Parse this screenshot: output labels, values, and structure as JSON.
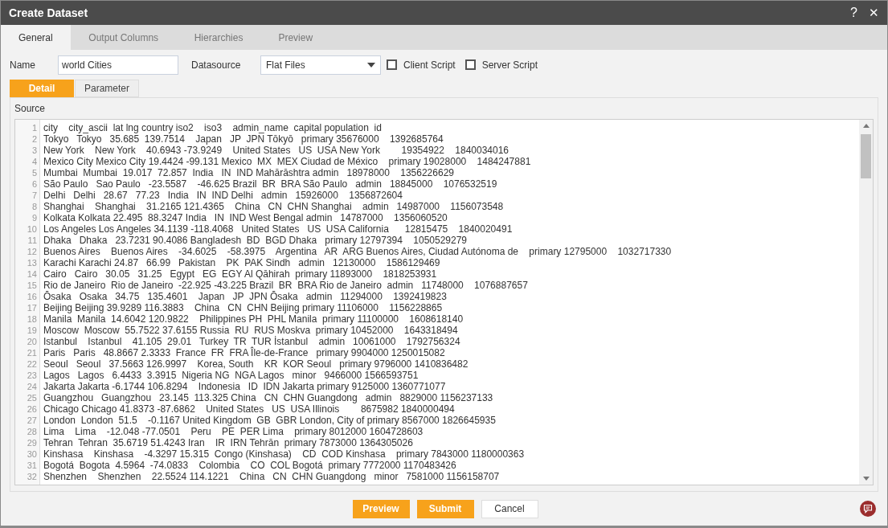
{
  "window": {
    "title": "Create Dataset",
    "help": "?",
    "close": "✕"
  },
  "tabs": [
    {
      "label": "General",
      "selected": true
    },
    {
      "label": "Output Columns",
      "selected": false
    },
    {
      "label": "Hierarchies",
      "selected": false
    },
    {
      "label": "Preview",
      "selected": false
    }
  ],
  "name_field": {
    "label": "Name",
    "value": "world Cities"
  },
  "datasource": {
    "label": "Datasource",
    "value": "Flat Files"
  },
  "checkboxes": [
    {
      "label": "Client Script",
      "checked": false
    },
    {
      "label": "Server Script",
      "checked": false
    }
  ],
  "subtabs": [
    {
      "label": "Detail",
      "selected": true
    },
    {
      "label": "Parameter",
      "selected": false
    }
  ],
  "source": {
    "label": "Source",
    "lines": [
      {
        "number": "1",
        "text": "city    city_ascii  lat lng country iso2    iso3    admin_name  capital population  id"
      },
      {
        "number": "2",
        "text": "Tokyo   Tokyo   35.685  139.7514    Japan   JP  JPN Tōkyō   primary 35676000    1392685764"
      },
      {
        "number": "3",
        "text": "New York    New York    40.6943 -73.9249    United States   US  USA New York        19354922    1840034016"
      },
      {
        "number": "4",
        "text": "Mexico City Mexico City 19.4424 -99.131 Mexico  MX  MEX Ciudad de México    primary 19028000    1484247881"
      },
      {
        "number": "5",
        "text": "Mumbai  Mumbai  19.017  72.857  India   IN  IND Mahārāshtra admin   18978000    1356226629"
      },
      {
        "number": "6",
        "text": "São Paulo   Sao Paulo   -23.5587    -46.625 Brazil  BR  BRA São Paulo   admin   18845000    1076532519"
      },
      {
        "number": "7",
        "text": "Delhi   Delhi   28.67   77.23   India   IN  IND Delhi   admin   15926000    1356872604"
      },
      {
        "number": "8",
        "text": "Shanghai    Shanghai    31.2165 121.4365    China   CN  CHN Shanghai    admin   14987000    1156073548"
      },
      {
        "number": "9",
        "text": "Kolkata Kolkata 22.495  88.3247 India   IN  IND West Bengal admin   14787000    1356060520"
      },
      {
        "number": "10",
        "text": "Los Angeles Los Angeles 34.1139 -118.4068   United States   US  USA California      12815475    1840020491"
      },
      {
        "number": "11",
        "text": "Dhaka   Dhaka   23.7231 90.4086 Bangladesh  BD  BGD Dhaka   primary 12797394    1050529279"
      },
      {
        "number": "12",
        "text": "Buenos Aires    Buenos Aires    -34.6025    -58.3975    Argentina   AR  ARG Buenos Aires, Ciudad Autónoma de    primary 12795000    1032717330"
      },
      {
        "number": "13",
        "text": "Karachi Karachi 24.87   66.99   Pakistan    PK  PAK Sindh   admin   12130000    1586129469"
      },
      {
        "number": "14",
        "text": "Cairo   Cairo   30.05   31.25   Egypt   EG  EGY Al Qāhirah  primary 11893000    1818253931"
      },
      {
        "number": "15",
        "text": "Rio de Janeiro  Rio de Janeiro  -22.925 -43.225 Brazil  BR  BRA Rio de Janeiro  admin   11748000    1076887657"
      },
      {
        "number": "16",
        "text": "Ōsaka   Osaka   34.75   135.4601    Japan   JP  JPN Ōsaka   admin   11294000    1392419823"
      },
      {
        "number": "17",
        "text": "Beijing Beijing 39.9289 116.3883    China   CN  CHN Beijing primary 11106000    1156228865"
      },
      {
        "number": "18",
        "text": "Manila  Manila  14.6042 120.9822    Philippines PH  PHL Manila  primary 11100000    1608618140"
      },
      {
        "number": "19",
        "text": "Moscow  Moscow  55.7522 37.6155 Russia  RU  RUS Moskva  primary 10452000    1643318494"
      },
      {
        "number": "20",
        "text": "Istanbul    Istanbul    41.105  29.01   Turkey  TR  TUR İstanbul    admin   10061000    1792756324"
      },
      {
        "number": "21",
        "text": "Paris   Paris   48.8667 2.3333  France  FR  FRA Île-de-France   primary 9904000 1250015082"
      },
      {
        "number": "22",
        "text": "Seoul   Seoul   37.5663 126.9997    Korea, South    KR  KOR Seoul   primary 9796000 1410836482"
      },
      {
        "number": "23",
        "text": "Lagos   Lagos   6.4433  3.3915  Nigeria NG  NGA Lagos   minor   9466000 1566593751"
      },
      {
        "number": "24",
        "text": "Jakarta Jakarta -6.1744 106.8294    Indonesia   ID  IDN Jakarta primary 9125000 1360771077"
      },
      {
        "number": "25",
        "text": "Guangzhou   Guangzhou   23.145  113.325 China   CN  CHN Guangdong   admin   8829000 1156237133"
      },
      {
        "number": "26",
        "text": "Chicago Chicago 41.8373 -87.6862    United States   US  USA Illinois        8675982 1840000494"
      },
      {
        "number": "27",
        "text": "London  London  51.5    -0.1167 United Kingdom  GB  GBR London, City of primary 8567000 1826645935"
      },
      {
        "number": "28",
        "text": "Lima    Lima    -12.048 -77.0501    Peru    PE  PER Lima    primary 8012000 1604728603"
      },
      {
        "number": "29",
        "text": "Tehran  Tehran  35.6719 51.4243 Iran    IR  IRN Tehrān  primary 7873000 1364305026"
      },
      {
        "number": "30",
        "text": "Kinshasa    Kinshasa    -4.3297 15.315  Congo (Kinshasa)    CD  COD Kinshasa    primary 7843000 1180000363"
      },
      {
        "number": "31",
        "text": "Bogotá  Bogota  4.5964  -74.0833    Colombia    CO  COL Bogotá  primary 7772000 1170483426"
      },
      {
        "number": "32",
        "text": "Shenzhen    Shenzhen    22.5524 114.1221    China   CN  CHN Guangdong   minor   7581000 1156158707"
      }
    ]
  },
  "buttons": [
    {
      "label": "Preview",
      "kind": "primary"
    },
    {
      "label": "Submit",
      "kind": "primary"
    },
    {
      "label": "Cancel",
      "kind": "secondary"
    }
  ]
}
